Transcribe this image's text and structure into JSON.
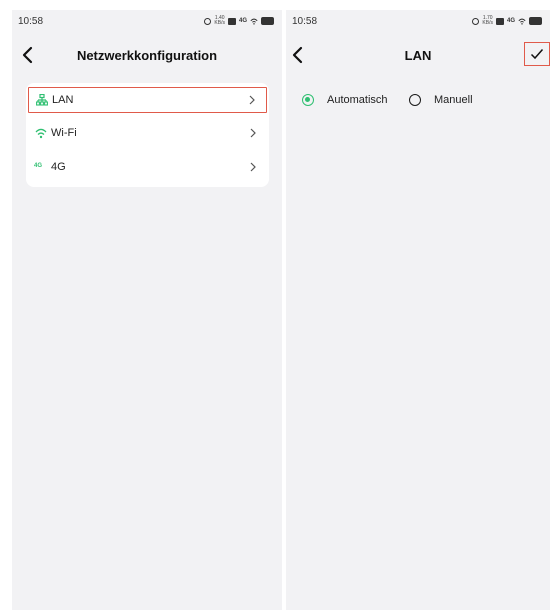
{
  "left_screen": {
    "status": {
      "time": "10:58",
      "speed": "1.40\nKB/s",
      "signal": "4G"
    },
    "nav": {
      "title": "Netzwerkkonfiguration"
    },
    "menu": [
      {
        "label": "LAN",
        "icon": "lan-icon",
        "highlighted": true
      },
      {
        "label": "Wi-Fi",
        "icon": "wifi-icon",
        "highlighted": false
      },
      {
        "label": "4G",
        "icon": "cellular-4g-icon",
        "badge": "4G",
        "highlighted": false
      }
    ]
  },
  "right_screen": {
    "status": {
      "time": "10:58",
      "speed": "1.70\nKB/s",
      "signal": "4G"
    },
    "nav": {
      "title": "LAN",
      "confirm_icon": "checkmark-icon"
    },
    "options": [
      {
        "label": "Automatisch",
        "selected": true
      },
      {
        "label": "Manuell",
        "selected": false
      }
    ]
  },
  "colors": {
    "accent": "#2fbf71",
    "highlight_border": "#e05a4a",
    "panel_bg": "#f2f2f4"
  }
}
